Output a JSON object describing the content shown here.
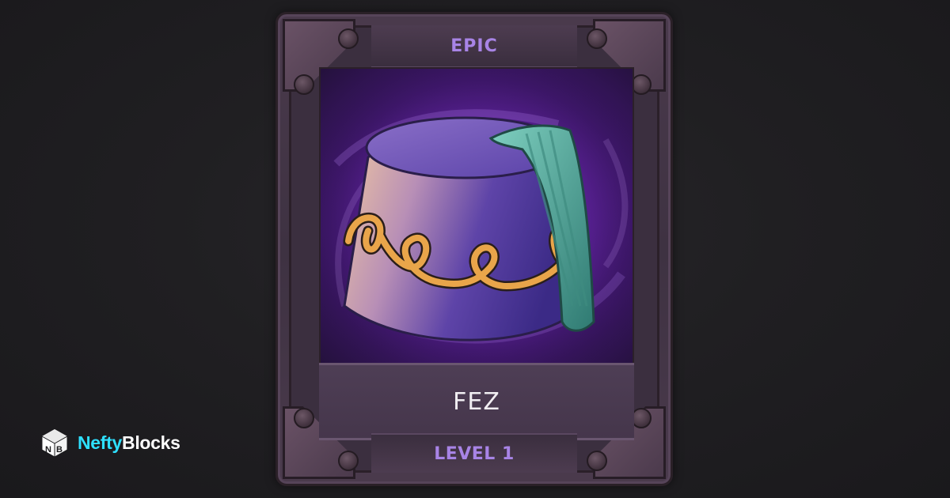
{
  "card": {
    "rarity": "EPIC",
    "name": "FEZ",
    "level": "LEVEL 1",
    "art": "fez-hat-illustration",
    "colors": {
      "rarity_text": "#a884e6",
      "art_background": "#6a2bb8",
      "frame": "#45364b",
      "hat_body": "#5a3fa8",
      "hat_cord": "#e9a54a",
      "tassel": "#4fa597"
    }
  },
  "brand": {
    "part1": "Nefty",
    "part2": "Blocks",
    "logo_icon": "nefty-blocks-cube-icon",
    "colors": {
      "accent": "#2ee0ff",
      "text": "#ffffff"
    }
  }
}
